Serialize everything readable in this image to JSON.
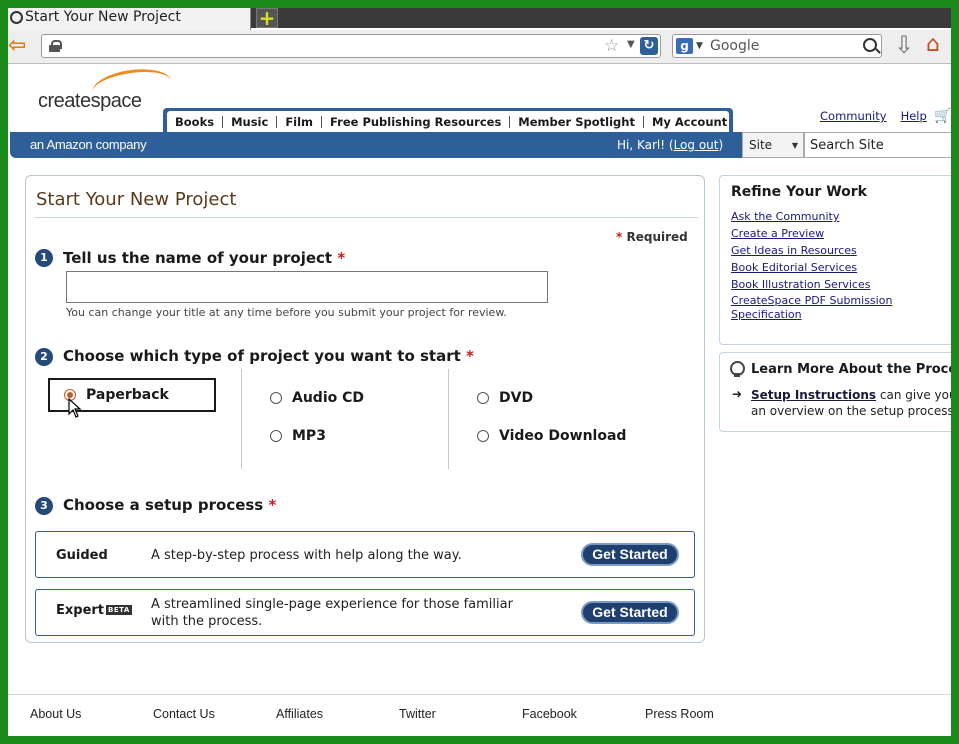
{
  "browser": {
    "tab_title": "Start Your New Project",
    "new_tab_label": "+",
    "url": "",
    "search_engine": "Google"
  },
  "header": {
    "logo_text": "createspace",
    "tagline": "an Amazon company",
    "nav": [
      "Books",
      "Music",
      "Film",
      "Free Publishing Resources",
      "Member Spotlight",
      "My Account"
    ],
    "util_links": [
      "Community",
      "Help"
    ],
    "greeting_prefix": "Hi, Karl! (",
    "logout": "Log out",
    "greeting_suffix": ")",
    "site_select": "Site",
    "site_search_placeholder": "Search Site"
  },
  "main": {
    "title": "Start Your New Project",
    "required_star": "*",
    "required_label": "Required",
    "step1": {
      "num": "1",
      "label": "Tell us the name of your project",
      "star": "*",
      "input_value": "",
      "hint": "You can change your title at any time before you submit your project for review."
    },
    "step2": {
      "num": "2",
      "label": "Choose which type of project you want to start",
      "star": "*",
      "options": [
        {
          "label": "Paperback",
          "selected": true
        },
        {
          "label": "Audio CD",
          "selected": false
        },
        {
          "label": "DVD",
          "selected": false
        },
        {
          "label": "MP3",
          "selected": false
        },
        {
          "label": "Video Download",
          "selected": false
        }
      ]
    },
    "step3": {
      "num": "3",
      "label": "Choose a setup process",
      "star": "*",
      "guided": {
        "name": "Guided",
        "desc": "A step-by-step process with help along the way.",
        "button": "Get Started"
      },
      "expert": {
        "name": "Expert",
        "badge": "BETA",
        "desc_line1": "A streamlined single-page experience for those familiar",
        "desc_line2": "with the process.",
        "button": "Get Started"
      }
    }
  },
  "sidebar": {
    "refine_title": "Refine Your Work",
    "refine_links": [
      "Ask the Community",
      "Create a Preview",
      "Get Ideas in Resources",
      "Book Editorial Services",
      "Book Illustration Services",
      "CreateSpace PDF Submission",
      "Specification"
    ],
    "learn_title": "Learn More About the Process",
    "learn_link": "Setup Instructions",
    "learn_text_after": " can give you an overview on the setup process."
  },
  "footer": {
    "links": [
      "About Us",
      "Contact Us",
      "Affiliates",
      "Twitter",
      "Facebook",
      "Press Room"
    ]
  },
  "colors": {
    "brand_blue": "#2f5f99",
    "title_brown": "#5a3a1a",
    "required_red": "#c02020",
    "window_border": "#1a8a1a"
  }
}
